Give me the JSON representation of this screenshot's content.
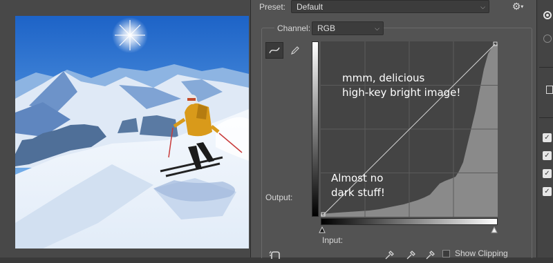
{
  "panel": {
    "preset_label": "Preset:",
    "preset_value": "Default",
    "channel_label": "Channel:",
    "channel_value": "RGB",
    "output_label": "Output:",
    "input_label": "Input:",
    "show_clipping_label": "Show Clipping",
    "show_clipping_checked": false
  },
  "annotations": {
    "note_top_line1": "mmm, delicious",
    "note_top_line2": "high-key bright image!",
    "note_bottom_line1": "Almost no",
    "note_bottom_line2": "dark stuff!"
  },
  "icons": {
    "gear": "gear-icon",
    "curve_tool": "curve-edit-icon",
    "pencil_tool": "pencil-icon",
    "hand_tool": "on-image-adjust-icon",
    "eyedroppers": [
      "black-point-eyedropper-icon",
      "gray-point-eyedropper-icon",
      "white-point-eyedropper-icon"
    ]
  },
  "colors": {
    "panel_bg": "#535353",
    "graph_bg": "#444444",
    "histogram": "#8a8a8a"
  },
  "right_strip": {
    "checkbox_states": [
      true,
      true,
      true,
      true
    ]
  }
}
